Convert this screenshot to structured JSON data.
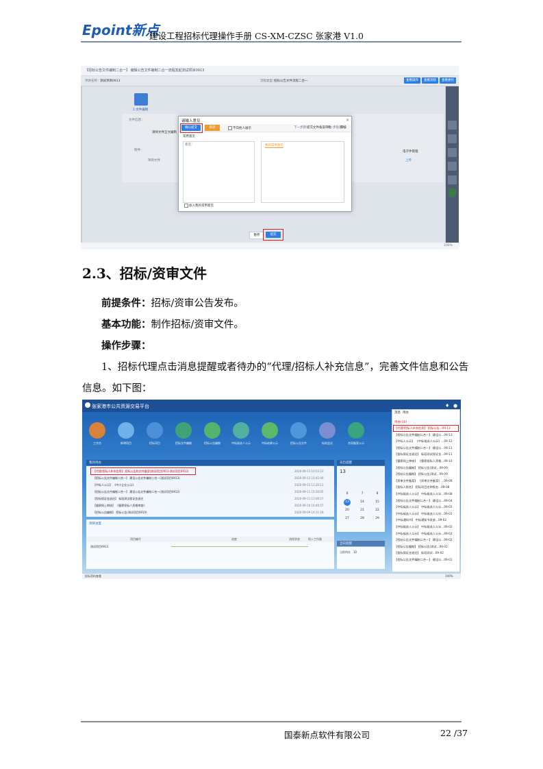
{
  "header": {
    "logo": "Epoint新点",
    "title": "建设工程招标代理操作手册 CS-XM-CZSC 张家港 V1.0"
  },
  "screenshot1": {
    "breadcrumb": "【招标公告文件编制二合一】 编辑公告文件编制二合一流程发起测试项目0913",
    "project_label": "项目名称：",
    "project_value": "测试项目0913",
    "flow_label": "流程类型：",
    "flow_value": "招标公告文件流程二合一",
    "top_buttons": [
      "查看操作",
      "查看流程",
      "查看委托"
    ],
    "step_label": "1.文件编制",
    "form_label": "文件信息：",
    "form_note": "请将文件正文编制",
    "form_label2": "附件：",
    "form_label3": "项目文件",
    "manage_label": "电子件管理",
    "upload_label": "上传",
    "dialog": {
      "title": "请输入意见",
      "confirm": "确认提交",
      "other": "取消",
      "checkbox1": "不向他人展示",
      "next_step_label": "下一步骤：",
      "next_step_value": "提交文件备案审批",
      "next_handler_label": "下一步处理人：",
      "next_handler_value": "审核",
      "opinion_tab": "常用意见",
      "box_label": "意见：",
      "common_title": "我的常用意见",
      "add_common": "加入我的常用意见"
    },
    "bottom_buttons": [
      "暂存",
      "提交"
    ],
    "side_buttons": [
      "提醒",
      "帮助",
      "流程",
      "操作记录",
      "附件"
    ],
    "zoom": "100%"
  },
  "section": {
    "heading": "2.3、招标/资审文件",
    "precondition_label": "前提条件：",
    "precondition_text": "招标/资审公告发布。",
    "function_label": "基本功能：",
    "function_text": "制作招标/资审文件。",
    "steps_label": "操作步骤：",
    "step1_line1": "1、招标代理点击消息提醒或者待办的“代理/招标人补充信息”，完善文件信息和公告",
    "step1_line2": "信息。如下图："
  },
  "screenshot2": {
    "platform_title": "张家港市公共资源交易平台",
    "apps": [
      "工作台",
      "新增项目",
      "招标项目",
      "招标文件编制",
      "招标公告编制",
      "中标候选人公示",
      "中标结果公示",
      "招标公告文件",
      "标前会议",
      "合同备案公示"
    ],
    "todo_title": "我的待办",
    "todos": [
      {
        "text": "【代理/招标人补充信息】 招标公告和文件备案(测试项目0913-测试项目0913)",
        "date": "2020-09-13 10:52:23"
      },
      {
        "text": "【招标公告文件编制二合一】 建设公告文件编制二合一(测试项目0913)",
        "date": "2020-09-13 10:42:46"
      },
      {
        "text": "【中标人公示】 《中小企业公示》",
        "date": "2020-09-12 11:20:11"
      },
      {
        "text": "【招标公告文件编制二合一】 建设公告文件编制二合一(测试项目0912)",
        "date": "2020-09-11 15:30:05"
      },
      {
        "text": "【投标保证金退还】 标段测试保证金退还",
        "date": "2020-09-11 11:00:27"
      },
      {
        "text": "【督察网上审核】 《督察投标人资格审查》",
        "date": "2020-09-10 16:46:57"
      },
      {
        "text": "【招标公告编制】 招标公告(测试项目0910)",
        "date": "2020-09-09 14:11:18"
      }
    ],
    "calendar_title": "日历提醒",
    "calendar_day": "13",
    "calendar_rows": [
      [
        "6",
        "7",
        "8"
      ],
      [
        "13",
        "14",
        "15"
      ],
      [
        "20",
        "21",
        "22"
      ],
      [
        "27",
        "28",
        "29"
      ]
    ],
    "stats_title": "当日提醒",
    "stats_label": "当前待办",
    "stats_value": "10",
    "project_table_title": "项目进度",
    "project_table_col1": "项目编号",
    "project_table_col2": "进度",
    "project_table_col3": "流程状态",
    "project_table_col4": "投入工作量",
    "project_row": "测试项目0913",
    "msg_tabs": [
      "消息",
      "待办"
    ],
    "msg_count": "待办(10)",
    "msgs": [
      "【代理/招标人补充信息】 招标公告...09-13",
      "【招标公告文件编制二合一】 建设公...09-13",
      "【中标人公示】 《中标候选人公示》...09-12",
      "【招标公告文件编制二合一】 建设公...09-11",
      "【投标保证金退还】 标段测试保证金...09-11",
      "【督察网上审核】 《督察投标人资格...09-10",
      "【招标公告编制】 招标公告(测试...09-09",
      "【招标公告编制】 招标公告(测试...09-09",
      "【资审文件备案】 《资审文件备案》...09-09",
      "【投标人报名】 招标项目名称报名...09-08",
      "【中标候选人公示】 中标候选人公示...09-08",
      "【招标公告文件编制二合一】 建设公...09-04",
      "【中标候选人公示】 中标候选人公示...09-03",
      "【中标候选人公示】 中标候选人公示...09-03",
      "【中标通知书】 中标通知书发放...09-02",
      "【中标候选人公示】 中标候选人公示...09-02",
      "【中标候选人公示】 中标候选人公示...09-02",
      "【招标公告文件编制二合一】 建设公...09-02",
      "【招标公告编制】 招标公告(测试...09-02",
      "【投标保证金退还】 标段测试...09-02",
      "【招标公告文件编制二合一】 建设公...09-01"
    ],
    "status": "投标资料查看",
    "zoom": "100%"
  },
  "footer": {
    "company": "国泰新点软件有限公司",
    "page": "22 /37"
  },
  "colors": {
    "logo_blue": "#1f5db5",
    "accent_red": "#e02020",
    "button_blue": "#2f7fe0",
    "orange": "#f29a2e"
  }
}
